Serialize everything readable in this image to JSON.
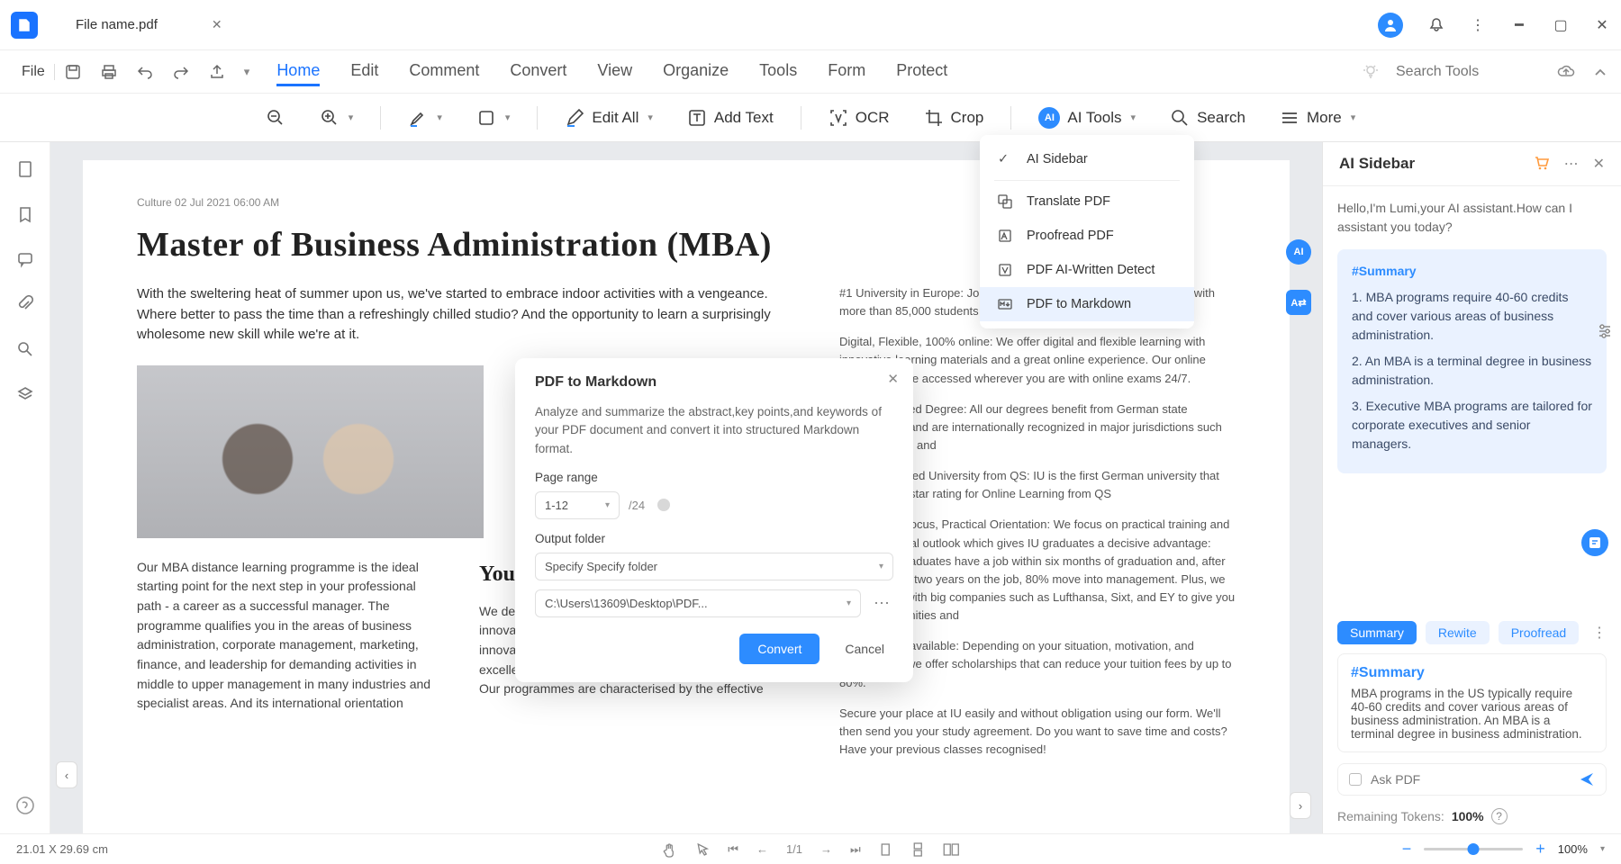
{
  "titlebar": {
    "filename": "File name.pdf"
  },
  "menubar": {
    "file": "File",
    "tabs": [
      "Home",
      "Edit",
      "Comment",
      "Convert",
      "View",
      "Organize",
      "Tools",
      "Form",
      "Protect"
    ],
    "active_tab": "Home",
    "search_placeholder": "Search Tools"
  },
  "toolbar": {
    "edit_all": "Edit All",
    "add_text": "Add Text",
    "ocr": "OCR",
    "crop": "Crop",
    "ai_tools": "AI Tools",
    "search": "Search",
    "more": "More"
  },
  "ai_menu": {
    "items": [
      "AI Sidebar",
      "Translate PDF",
      "Proofread PDF",
      "PDF AI-Written Detect",
      "PDF to Markdown"
    ],
    "selected": "PDF to Markdown"
  },
  "doc": {
    "meta": "Culture 02 Jul 2021 06:00 AM",
    "title": "Master of Business Administration (MBA)",
    "intro": "With the sweltering heat of summer upon us, we've started to embrace indoor activities with a vengeance. Where better to pass the time than a refreshingly chilled studio? And the opportunity to learn a surprisingly wholesome new skill while we're at it.",
    "col1": "Our MBA distance learning programme is the ideal starting point for the next step in your professional path - a career as a successful manager. The programme qualifies you in the areas of business administration, corporate management, marketing, finance, and leadership for demanding activities in middle to upper management in many industries and specialist areas. And its international orientation",
    "h2": "Your de",
    "col2": "We design our programmes to be as flexible and innovative quality. We deliver specialist expertise and innovative learning materials as well as focusing on excellent student services and professional advice. Our programmes are characterised by the effective",
    "col3_items": [
      "#1 University in Europe: Join the largest private university in Europe with more than 85,000 students",
      "Digital, Flexible, 100% online: We offer digital and flexible learning with innovative learning materials and a great online experience. Our online campus can be accessed wherever you are with online exams 24/7.",
      "Fully Accredited Degree: All our degrees benefit from German state accreditation and are internationally recognized in major jurisdictions such as the EU, US and",
      "First 5-star rated University from QS: IU is the first German university that achieved a 5-star rating for Online Learning from QS",
      "International focus, Practical Orientation: We focus on practical training and an international outlook which gives IU graduates a decisive advantage: 94% of our graduates have a job within six months of graduation and, after an average of two years on the job, 80% move into management. Plus, we work closely with big companies such as Lufthansa, Sixt, and EY to give you great opportunities and",
      "Scholarships available: Depending on your situation, motivation, and background, we offer scholarships that can reduce your tuition fees by up to 80%.",
      "Secure your place at IU easily and without obligation using our form. We'll then send you your study agreement. Do you want to save time and costs? Have your previous classes recognised!"
    ]
  },
  "modal": {
    "title": "PDF to Markdown",
    "desc": "Analyze and summarize the abstract,key points,and keywords of your PDF document and convert it into structured Markdown format.",
    "page_range_label": "Page range",
    "range_value": "1-12",
    "total_pages": "/24",
    "output_folder_label": "Output folder",
    "folder_value": "Specify Specify folder",
    "path_value": "C:\\Users\\13609\\Desktop\\PDF...",
    "convert": "Convert",
    "cancel": "Cancel"
  },
  "sidebar": {
    "title": "AI Sidebar",
    "greeting": "Hello,I'm Lumi,your AI assistant.How can I assistant you today?",
    "summary_tag": "#Summary",
    "summary_points": [
      "1. MBA programs require 40-60 credits and cover various areas of business administration.",
      "2. An MBA is a terminal degree in business administration.",
      "3. Executive MBA programs are tailored for corporate executives and senior managers."
    ],
    "chips": [
      "Summary",
      "Rewite",
      "Proofread"
    ],
    "active_chip": "Summary",
    "bottom_tag": "#Summary",
    "bottom_text": "MBA programs in the US typically require 40-60 credits and cover various areas of business administration. An MBA is a terminal degree in business administration.",
    "ask_placeholder": "Ask PDF",
    "tokens_label": "Remaining Tokens:",
    "tokens_value": "100%"
  },
  "status": {
    "dims": "21.01 X 29.69 cm",
    "page": "1/1",
    "zoom": "100%"
  }
}
